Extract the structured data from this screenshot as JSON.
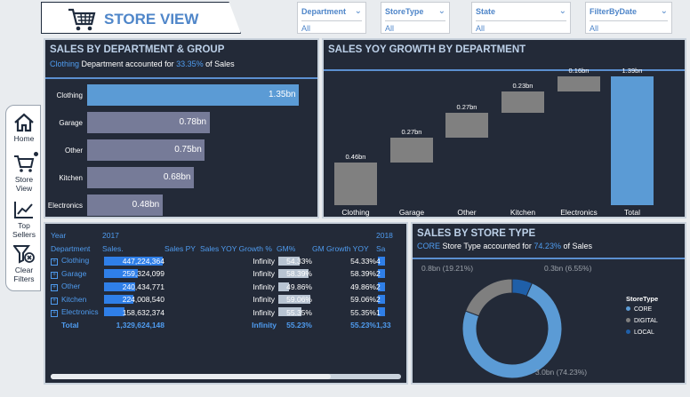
{
  "header": {
    "title": "STORE VIEW"
  },
  "filters": [
    {
      "label": "Department",
      "value": "All"
    },
    {
      "label": "StoreType",
      "value": "All"
    },
    {
      "label": "State",
      "value": "All"
    },
    {
      "label": "FilterByDate",
      "value": "All"
    }
  ],
  "nav": [
    {
      "label": "Home",
      "icon": "home-icon"
    },
    {
      "label": "Store View",
      "icon": "cart-icon"
    },
    {
      "label": "Top Sellers",
      "icon": "trend-icon"
    },
    {
      "label": "Clear Filters",
      "icon": "filter-clear-icon"
    }
  ],
  "dept_panel": {
    "title": "SALES BY DEPARTMENT & GROUP",
    "sub_hl1": "Clothing",
    "sub_mid": " Department accounted for ",
    "sub_hl2": "33.35%",
    "sub_end": " of Sales"
  },
  "yoy_panel": {
    "title": "SALES YOY GROWTH BY DEPARTMENT"
  },
  "storetype_panel": {
    "title": "SALES BY STORE TYPE",
    "sub_hl1": "CORE",
    "sub_mid": " Store Type accounted for ",
    "sub_hl2": "74.23%",
    "sub_end": " of Sales",
    "legend_title": "StoreType",
    "label_core": "3.0bn (74.23%)",
    "label_digital": "0.8bn (19.21%)",
    "label_local": "0.3bn (6.55%)"
  },
  "matrix": {
    "header_row1": [
      "Year",
      "2017",
      "",
      "",
      "",
      "",
      "2018"
    ],
    "header_row2": [
      "Department",
      "Sales.",
      "Sales PY",
      "Sales YOY Growth %",
      "GM%",
      "GM Growth YOY",
      "Sa"
    ],
    "rows": [
      {
        "dept": "Clothing",
        "sales": "447,224,364",
        "py": "",
        "yoy": "Infinity",
        "gm": "54.33%",
        "gmg": "54.33%"
      },
      {
        "dept": "Garage",
        "sales": "259,324,099",
        "py": "",
        "yoy": "Infinity",
        "gm": "58.39%",
        "gmg": "58.39%"
      },
      {
        "dept": "Other",
        "sales": "240,434,771",
        "py": "",
        "yoy": "Infinity",
        "gm": "49.86%",
        "gmg": "49.86%"
      },
      {
        "dept": "Kitchen",
        "sales": "224,008,540",
        "py": "",
        "yoy": "Infinity",
        "gm": "59.06%",
        "gmg": "59.06%"
      },
      {
        "dept": "Electronics",
        "sales": "158,632,374",
        "py": "",
        "yoy": "Infinity",
        "gm": "55.35%",
        "gmg": "55.35%"
      }
    ],
    "total": {
      "dept": "Total",
      "sales": "1,329,624,148",
      "py": "",
      "yoy": "Infinity",
      "gm": "55.23%",
      "gmg": "55.23%",
      "next": "1,33"
    },
    "next_col": [
      "4",
      "2",
      "2",
      "2",
      "1"
    ]
  },
  "chart_data": [
    {
      "type": "bar",
      "orientation": "horizontal",
      "categories": [
        "Clothing",
        "Garage",
        "Other",
        "Kitchen",
        "Electronics"
      ],
      "values": [
        1.35,
        0.78,
        0.75,
        0.68,
        0.48
      ],
      "labels": [
        "1.35bn",
        "0.78bn",
        "0.75bn",
        "0.68bn",
        "0.48bn"
      ],
      "unit": "bn",
      "colors": [
        "#5b9bd5",
        "#767b98",
        "#767b98",
        "#767b98",
        "#767b98"
      ]
    },
    {
      "type": "bar",
      "subtype": "waterfall",
      "categories": [
        "Clothing",
        "Garage",
        "Other",
        "Kitchen",
        "Electronics",
        "Total"
      ],
      "values": [
        0.46,
        0.27,
        0.27,
        0.23,
        0.16,
        1.39
      ],
      "labels": [
        "0.46bn",
        "0.27bn",
        "0.27bn",
        "0.23bn",
        "0.16bn",
        "1.39bn"
      ],
      "colors": {
        "step": "#808080",
        "total": "#5b9bd5"
      }
    },
    {
      "type": "pie",
      "subtype": "donut",
      "categories": [
        "CORE",
        "DIGITAL",
        "LOCAL"
      ],
      "values": [
        74.23,
        19.21,
        6.55
      ],
      "colors": [
        "#5b9bd5",
        "#7f7f7f",
        "#1f5fa8"
      ],
      "legend": "right"
    }
  ]
}
